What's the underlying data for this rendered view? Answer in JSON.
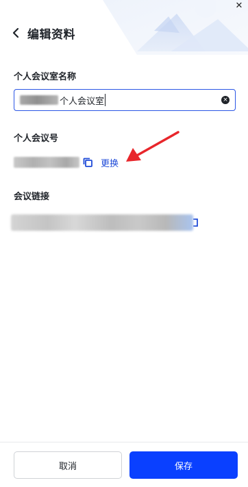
{
  "window": {
    "close_icon": "close-icon",
    "close_glyph": "✕"
  },
  "header": {
    "back_icon": "chevron-left-icon",
    "title": "编辑资料"
  },
  "room_name": {
    "label": "个人会议室名称",
    "value": "个人会议室",
    "clear_icon": "clear-icon",
    "clear_glyph": "×"
  },
  "room_number": {
    "label": "个人会议号",
    "copy_icon": "copy-icon",
    "change_label": "更换"
  },
  "meeting_link": {
    "label": "会议链接",
    "copy_icon": "copy-icon"
  },
  "footer": {
    "cancel_label": "取消",
    "save_label": "保存"
  },
  "colors": {
    "accent": "#0a40ff",
    "link": "#1f4bd8",
    "annotation_arrow": "#e8262b"
  }
}
